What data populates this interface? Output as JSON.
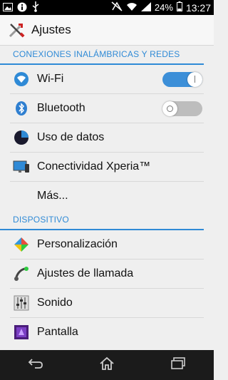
{
  "status_bar": {
    "icons_left": [
      "image-icon",
      "info-icon",
      "usb-icon"
    ],
    "icons_right": [
      "nfc-off-icon",
      "wifi-icon",
      "signal-icon",
      "battery-icon"
    ],
    "battery": "24%",
    "time": "13:27"
  },
  "header": {
    "title": "Ajustes",
    "icon": "tools-icon"
  },
  "sections": [
    {
      "title": "CONEXIONES INALÁMBRICAS Y REDES",
      "items": [
        {
          "label": "Wi-Fi",
          "icon": "wifi-icon",
          "toggle": "on"
        },
        {
          "label": "Bluetooth",
          "icon": "bluetooth-icon",
          "toggle": "off"
        },
        {
          "label": "Uso de datos",
          "icon": "data-usage-icon"
        },
        {
          "label": "Conectividad Xperia™",
          "icon": "xperia-connectivity-icon"
        },
        {
          "label": "Más..."
        }
      ]
    },
    {
      "title": "DISPOSITIVO",
      "items": [
        {
          "label": "Personalización",
          "icon": "personalization-icon"
        },
        {
          "label": "Ajustes de llamada",
          "icon": "phone-icon"
        },
        {
          "label": "Sonido",
          "icon": "equalizer-icon"
        },
        {
          "label": "Pantalla",
          "icon": "display-icon"
        }
      ]
    }
  ],
  "nav_bar": {
    "buttons": [
      "back-icon",
      "home-icon",
      "recents-icon"
    ]
  },
  "colors": {
    "accent": "#2f8ad6",
    "toggle_on": "#3c8fd8",
    "toggle_off": "#bdbdbd"
  }
}
